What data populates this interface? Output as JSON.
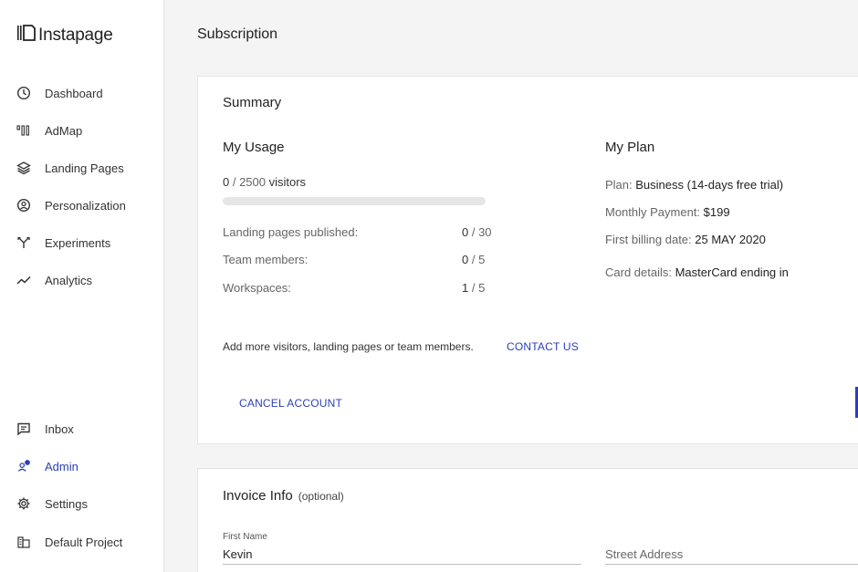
{
  "app": {
    "name": "Instapage"
  },
  "sidebar": {
    "items": [
      {
        "label": "Dashboard",
        "icon": "dashboard-icon"
      },
      {
        "label": "AdMap",
        "icon": "admap-icon"
      },
      {
        "label": "Landing Pages",
        "icon": "layers-icon"
      },
      {
        "label": "Personalization",
        "icon": "personalization-icon"
      },
      {
        "label": "Experiments",
        "icon": "experiments-icon"
      },
      {
        "label": "Analytics",
        "icon": "analytics-icon"
      }
    ],
    "bottom_items": [
      {
        "label": "Inbox",
        "icon": "inbox-icon"
      },
      {
        "label": "Admin",
        "icon": "admin-icon",
        "active": true
      },
      {
        "label": "Settings",
        "icon": "gear-icon"
      },
      {
        "label": "Default Project",
        "icon": "project-icon"
      }
    ]
  },
  "page": {
    "title": "Subscription"
  },
  "summary": {
    "title": "Summary",
    "usage": {
      "title": "My Usage",
      "visitors_used": "0",
      "visitors_total": " / 2500",
      "visitors_label": " visitors",
      "visitors_progress": 0,
      "rows": [
        {
          "label": "Landing pages published:",
          "used": "0",
          "total": " / 30"
        },
        {
          "label": "Team members:",
          "used": "0",
          "total": " / 5"
        },
        {
          "label": "Workspaces:",
          "used": "1",
          "total": " / 5"
        }
      ]
    },
    "plan": {
      "title": "My Plan",
      "plan_label": "Plan: ",
      "plan_value": "Business (14-days free trial)",
      "payment_label": "Monthly Payment: ",
      "payment_value": "$199",
      "billing_label": "First billing date: ",
      "billing_value": "25 MAY 2020",
      "card_label": "Card details: ",
      "card_value": "MasterCard ending in"
    },
    "upsell_text": "Add more visitors, landing pages or team members.",
    "contact_link": "CONTACT US",
    "cancel_link": "CANCEL ACCOUNT"
  },
  "invoice": {
    "title": "Invoice Info",
    "optional": "(optional)",
    "first_name_label": "First Name",
    "first_name_value": "Kevin",
    "street_placeholder": "Street Address"
  },
  "colors": {
    "accent": "#2b3fb8",
    "background": "#f4f4f4",
    "card": "#ffffff"
  }
}
